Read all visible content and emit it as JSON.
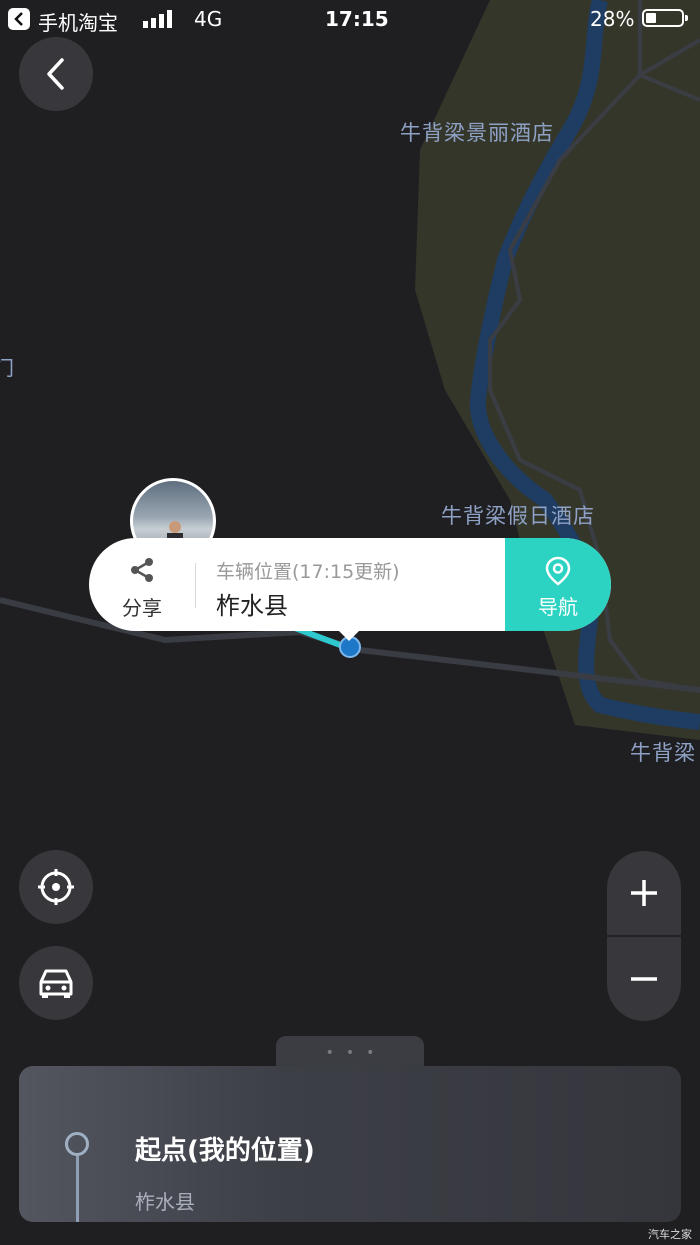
{
  "status_bar": {
    "back_app_name": "手机淘宝",
    "network": "4G",
    "time": "17:15",
    "battery_percent": "28%",
    "battery_level": 0.28
  },
  "map": {
    "labels": {
      "hotel_1": "牛背梁景丽酒店",
      "hotel_2": "牛背梁假日酒店",
      "edge": "牛背梁"
    }
  },
  "vehicle_popup": {
    "share_label": "分享",
    "title": "车辆位置(17:15更新)",
    "place": "柞水县",
    "navigate_label": "导航"
  },
  "bottom_sheet": {
    "start_title": "起点(我的位置)",
    "start_place": "柞水县",
    "handle_dots": "•••"
  },
  "watermark": "汽车之家",
  "colors": {
    "map_background": "#1f1f22",
    "terrain": "#34362a",
    "river": "#1e3a5c",
    "accent": "#2cd3c2",
    "label": "#8fa2c6"
  }
}
